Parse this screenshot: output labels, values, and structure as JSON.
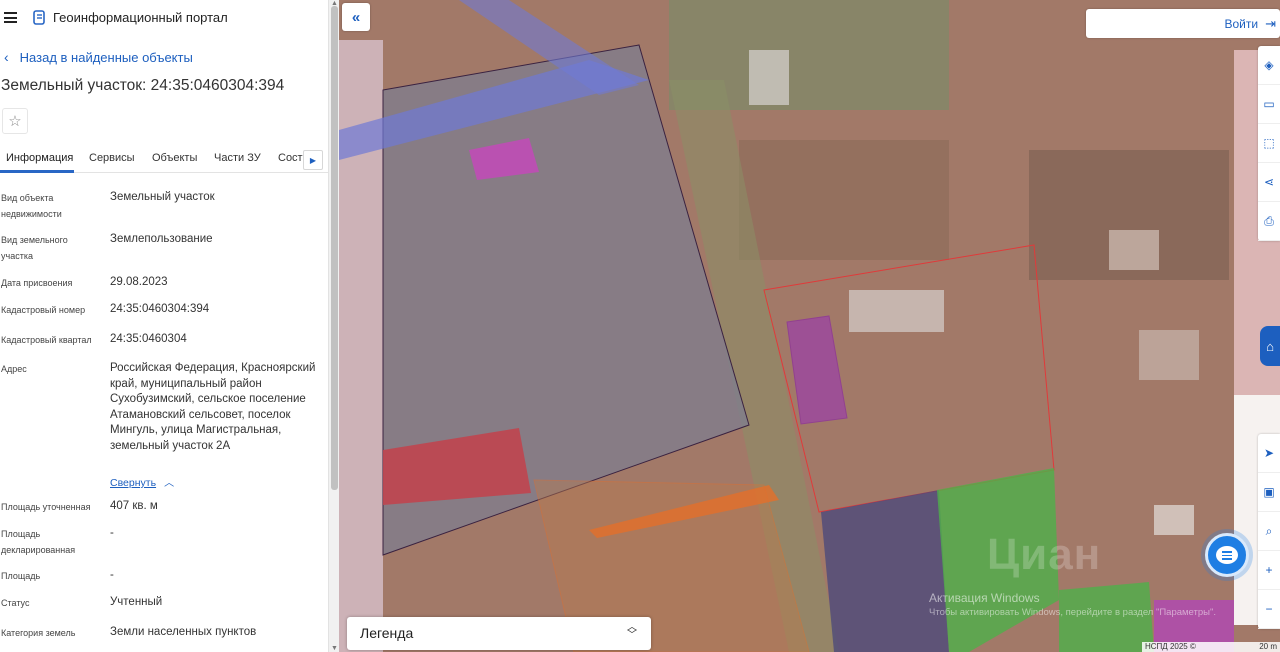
{
  "app": {
    "title": "Геоинформационный портал"
  },
  "nav": {
    "back_label": "Назад в найденные объекты"
  },
  "object": {
    "title": "Земельный участок: 24:35:0460304:394"
  },
  "tabs": [
    {
      "label": "Информация",
      "active": true
    },
    {
      "label": "Сервисы"
    },
    {
      "label": "Объекты"
    },
    {
      "label": "Части ЗУ"
    },
    {
      "label": "Соста"
    }
  ],
  "properties": [
    {
      "label": "Вид объекта недвижимости",
      "value": "Земельный участок"
    },
    {
      "label": "Вид земельного участка",
      "value": "Землепользование"
    },
    {
      "label": "Дата присвоения",
      "value": "29.08.2023"
    },
    {
      "label": "Кадастровый номер",
      "value": "24:35:0460304:394"
    },
    {
      "label": "Кадастровый квартал",
      "value": "24:35:0460304"
    },
    {
      "label": "Адрес",
      "value": "Российская Федерация, Красноярский край, муниципальный район Сухобузимский, сельское поселение Атамановский сельсовет, поселок Мингуль, улица Магистральная, земельный участок 2А"
    },
    {
      "label": "Площадь уточненная",
      "value": "407 кв. м"
    },
    {
      "label": "Площадь декларированная",
      "value": "-"
    },
    {
      "label": "Площадь",
      "value": "-"
    },
    {
      "label": "Статус",
      "value": "Учтенный"
    },
    {
      "label": "Категория земель",
      "value": "Земли населенных пунктов"
    }
  ],
  "collapse_label": "Свернуть",
  "map": {
    "login_label": "Войти",
    "legend_label": "Легенда",
    "watermark_title": "Активация Windows",
    "watermark_sub": "Чтобы активировать Windows, перейдите в раздел \"Параметры\".",
    "watermark_brand": "Циан",
    "attribution_left": "НСПД 2025 ©",
    "attribution_right": "20 m"
  },
  "icons": {
    "menu": "hamburger-icon",
    "logo": "portal-logo-icon",
    "back": "chevron-left-icon",
    "favorite": "star-icon",
    "collapse_panel": "double-chevron-left-icon",
    "login": "sign-in-icon",
    "layers": "layers-icon",
    "ruler": "ruler-icon",
    "select": "select-area-icon",
    "share": "share-icon",
    "print": "print-icon",
    "locate": "locate-icon",
    "chat": "chat-icon"
  },
  "colors": {
    "accent": "#1d5fbf",
    "tab_underline": "#2967c5",
    "chat": "#1e7ee3"
  }
}
